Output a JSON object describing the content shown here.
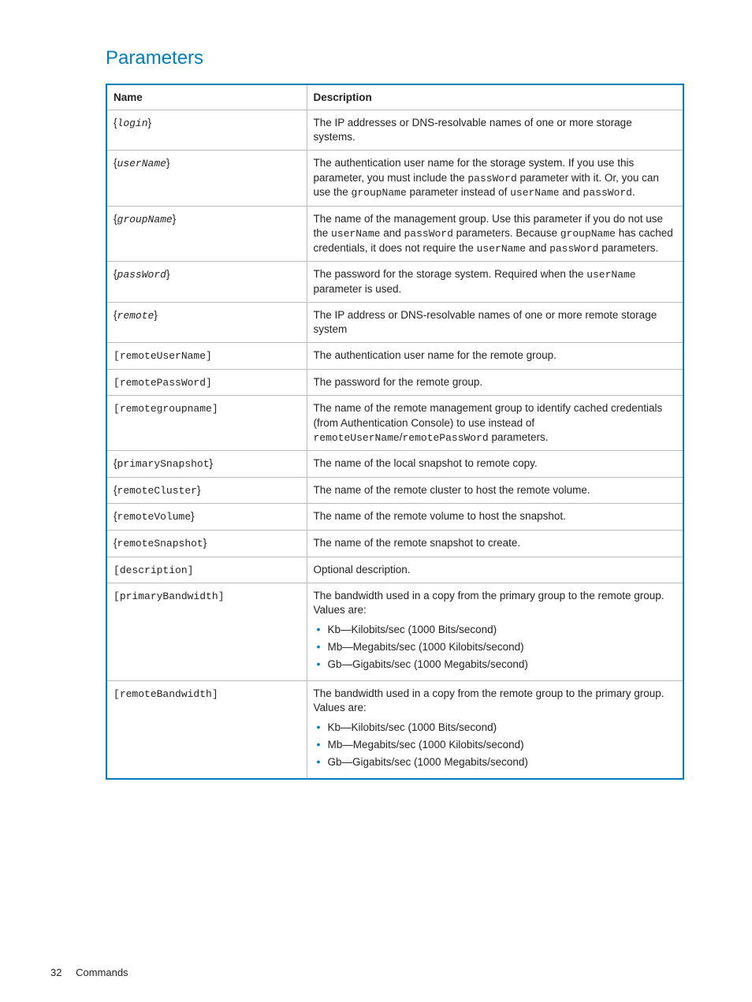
{
  "heading": "Parameters",
  "columns": {
    "name": "Name",
    "desc": "Description"
  },
  "rows": {
    "login": {
      "name_pre": "{",
      "name": "login",
      "name_post": "}",
      "desc": "The IP addresses or DNS-resolvable names of one or more storage systems."
    },
    "userName": {
      "name_pre": "{",
      "name": "userName",
      "name_post": "}",
      "desc_parts": [
        "The authentication user name for the storage system. If you use this parameter, you must include the ",
        "passWord",
        " parameter with it. Or, you can use the ",
        "groupName",
        " parameter instead of ",
        "userName",
        " and ",
        "passWord",
        "."
      ]
    },
    "groupName": {
      "name_pre": "{",
      "name": "groupName",
      "name_post": "}",
      "desc_parts": [
        "The name of the management group. Use this parameter if you do not use the ",
        "userName",
        " and ",
        "passWord",
        " parameters. Because ",
        "groupName",
        " has cached credentials, it does not require the ",
        "userName",
        " and ",
        "passWord",
        " parameters."
      ]
    },
    "passWord": {
      "name_pre": "{",
      "name": "passWord",
      "name_post": "}",
      "desc_parts": [
        "The password for the storage system. Required when the ",
        "userName",
        " parameter is used."
      ]
    },
    "remote": {
      "name_pre": "{",
      "name": "remote",
      "name_post": "}",
      "desc": "The IP address or DNS-resolvable names of one or more remote storage system"
    },
    "remoteUserName": {
      "name_pre": "[",
      "name": "remoteUserName",
      "name_post": "]",
      "desc": "The authentication user name for the remote group."
    },
    "remotePassWord": {
      "name_pre": "[",
      "name": "remotePassWord",
      "name_post": "]",
      "desc": "The password for the remote group."
    },
    "remotegroupname": {
      "name_pre": "[",
      "name": "remotegroupname",
      "name_post": "]",
      "desc_parts": [
        "The name of the remote management group to identify cached credentials (from Authentication Console) to use instead of ",
        "remoteUserName",
        "/",
        "remotePassWord",
        " parameters."
      ]
    },
    "primarySnapshot": {
      "name_pre": "{",
      "name": "primarySnapshot",
      "name_post": "}",
      "desc": "The name of the local snapshot to remote copy."
    },
    "remoteCluster": {
      "name_pre": "{",
      "name": "remoteCluster",
      "name_post": "}",
      "desc": "The name of the remote cluster to host the remote volume."
    },
    "remoteVolume": {
      "name_pre": "{",
      "name": "remoteVolume",
      "name_post": "}",
      "desc": "The name of the remote volume to host the snapshot."
    },
    "remoteSnapshot": {
      "name_pre": "{",
      "name": "remoteSnapshot",
      "name_post": "}",
      "desc": "The name of the remote snapshot to create."
    },
    "description": {
      "name_pre": "[",
      "name": "description",
      "name_post": "]",
      "desc": "Optional description."
    },
    "primaryBandwidth": {
      "name_pre": "[",
      "name": "primaryBandwidth",
      "name_post": "]",
      "desc_intro": "The bandwidth used in a copy from the primary group to the remote group. Values are:",
      "values": [
        "Kb—Kilobits/sec (1000 Bits/second)",
        "Mb—Megabits/sec (1000 Kilobits/second)",
        "Gb—Gigabits/sec (1000 Megabits/second)"
      ]
    },
    "remoteBandwidth": {
      "name_pre": "[",
      "name": "remoteBandwidth",
      "name_post": "]",
      "desc_intro": "The bandwidth used in a copy from the remote group to the primary group. Values are:",
      "values": [
        "Kb—Kilobits/sec (1000 Bits/second)",
        "Mb—Megabits/sec (1000 Kilobits/second)",
        "Gb—Gigabits/sec (1000 Megabits/second)"
      ]
    }
  },
  "footer": {
    "page": "32",
    "section": "Commands"
  }
}
